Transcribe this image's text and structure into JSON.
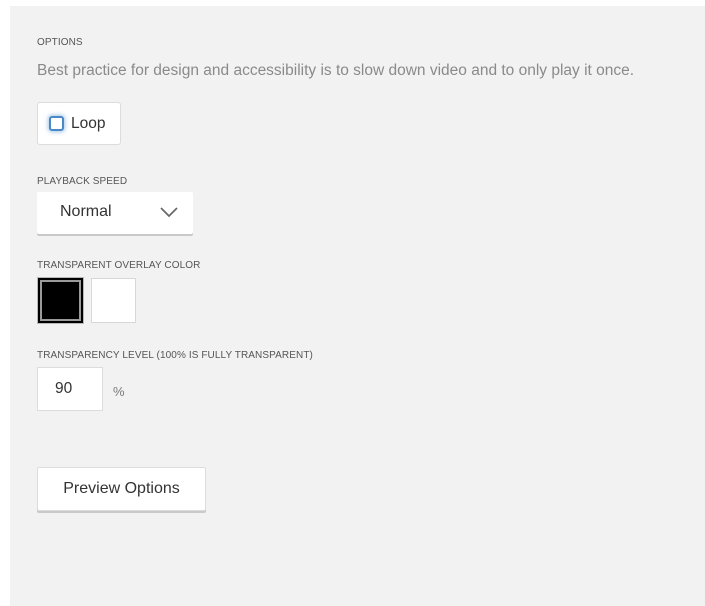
{
  "options": {
    "heading": "OPTIONS",
    "hint": "Best practice for design and accessibility is to slow down video and to only play it once."
  },
  "loop": {
    "label": "Loop",
    "checked": false
  },
  "playback_speed": {
    "label": "PLAYBACK SPEED",
    "selected": "Normal",
    "icon": "chevron-down-icon"
  },
  "overlay_color": {
    "label": "TRANSPARENT OVERLAY COLOR",
    "swatches": [
      {
        "color": "#000000",
        "selected": true
      },
      {
        "color": "#ffffff",
        "selected": false
      }
    ]
  },
  "transparency": {
    "label": "TRANSPARENCY LEVEL (100% IS FULLY TRANSPARENT)",
    "value": "90",
    "unit": "%"
  },
  "preview": {
    "label": "Preview Options"
  },
  "colors": {
    "panel_bg": "#f2f2f2",
    "checkbox_border": "#4a88c8"
  }
}
